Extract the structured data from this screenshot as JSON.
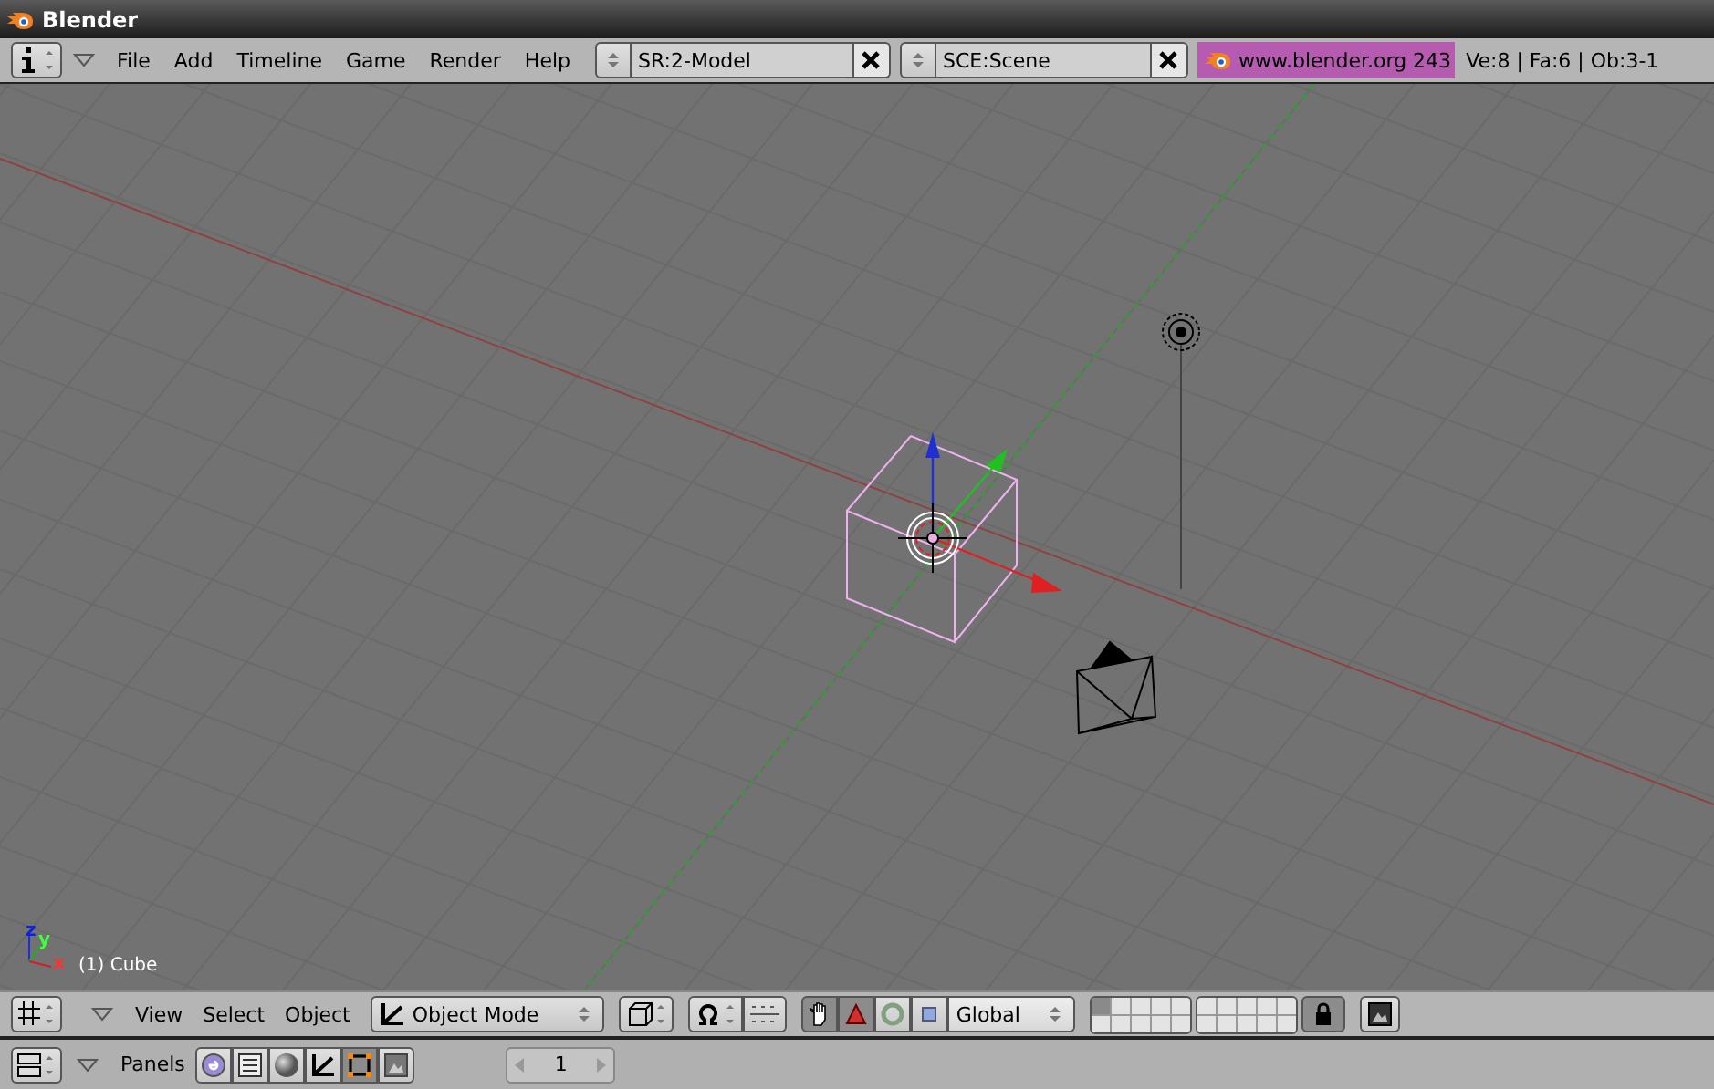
{
  "window": {
    "title": "Blender"
  },
  "top_header": {
    "menus": [
      "File",
      "Add",
      "Timeline",
      "Game",
      "Render",
      "Help"
    ],
    "screen": "SR:2-Model",
    "scene": "SCE:Scene",
    "site": "www.blender.org 243",
    "stats": "Ve:8 | Fa:6 | Ob:3-1"
  },
  "viewport": {
    "object_label": "(1) Cube",
    "axis_labels": [
      "z",
      "y",
      "x"
    ]
  },
  "view_header": {
    "menus": [
      "View",
      "Select",
      "Object"
    ],
    "mode": "Object Mode",
    "orientation": "Global",
    "manipulators": [
      {
        "kind": "hand",
        "selected": true
      },
      {
        "kind": "translate",
        "selected": true
      },
      {
        "kind": "rotate",
        "selected": false
      },
      {
        "kind": "scale",
        "selected": false
      }
    ],
    "layers": [
      {
        "selected": true
      },
      {
        "selected": false
      },
      {
        "selected": false
      },
      {
        "selected": false
      },
      {
        "selected": false
      },
      {
        "selected": false
      },
      {
        "selected": false
      },
      {
        "selected": false
      },
      {
        "selected": false
      },
      {
        "selected": false
      },
      {
        "selected": false
      },
      {
        "selected": false
      },
      {
        "selected": false
      },
      {
        "selected": false
      },
      {
        "selected": false
      },
      {
        "selected": false
      },
      {
        "selected": false
      },
      {
        "selected": false
      },
      {
        "selected": false
      },
      {
        "selected": false
      }
    ],
    "lock": {
      "on": true
    }
  },
  "buttons_header": {
    "label": "Panels",
    "tabs": [
      {
        "kind": "logic",
        "selected": false
      },
      {
        "kind": "script",
        "selected": false
      },
      {
        "kind": "shading",
        "selected": false
      },
      {
        "kind": "object",
        "selected": false
      },
      {
        "kind": "editing",
        "selected": true
      },
      {
        "kind": "scene",
        "selected": false
      }
    ],
    "frame": "1"
  }
}
